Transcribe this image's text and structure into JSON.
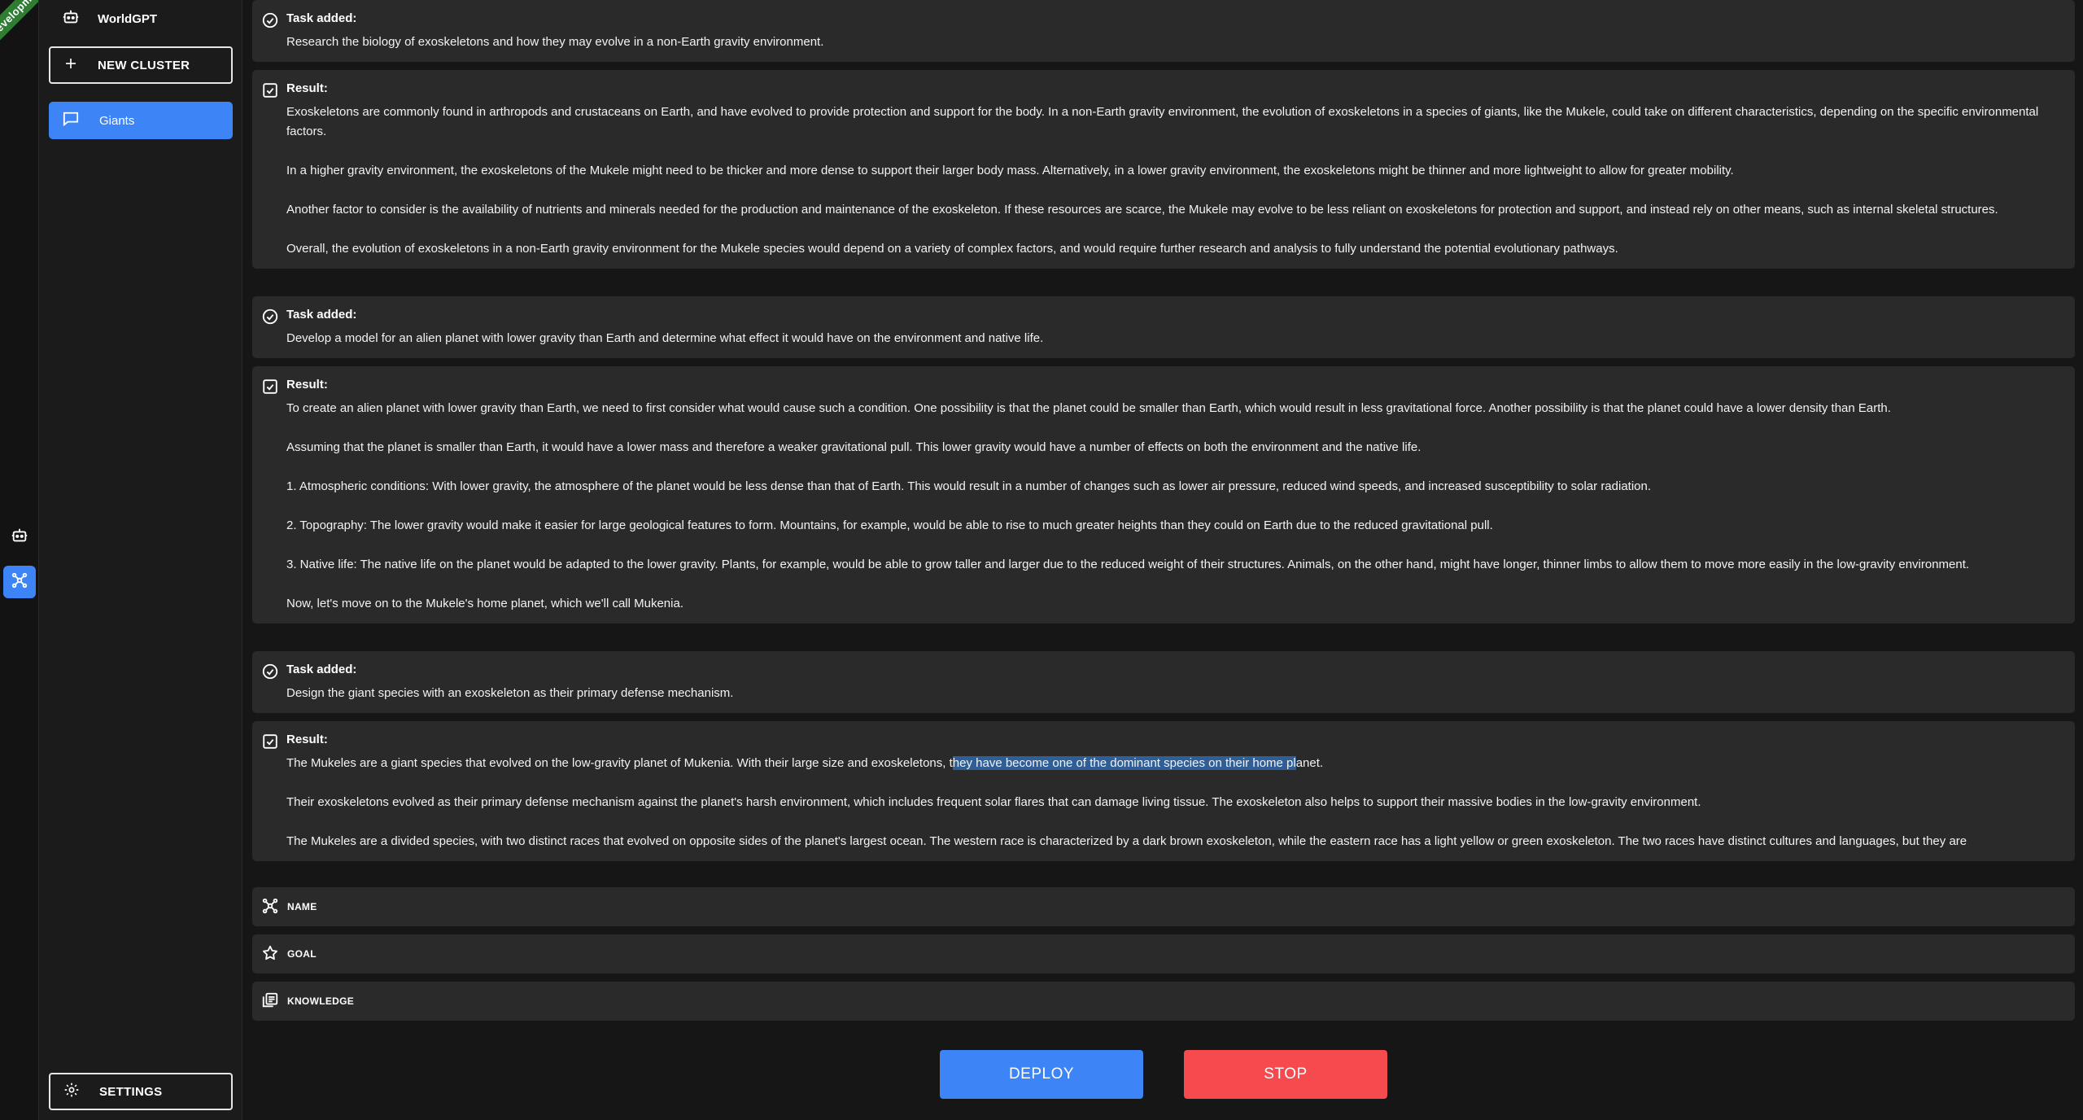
{
  "app": {
    "title": "WorldGPT",
    "ribbon_text": "Development",
    "accent_color": "#3d84f6",
    "danger_color": "#f54b4f"
  },
  "sidebar": {
    "new_cluster_label": "NEW CLUSTER",
    "clusters": [
      {
        "label": "Giants",
        "icon": "chat-bubble-icon"
      }
    ],
    "settings_label": "SETTINGS"
  },
  "feed": [
    {
      "type": "task",
      "header": "Task added:",
      "icon": "check-circle-icon",
      "paragraphs": [
        "Research the biology of exoskeletons and how they may evolve in a non-Earth gravity environment."
      ]
    },
    {
      "type": "result",
      "header": "Result:",
      "icon": "check-square-icon",
      "paragraphs": [
        "Exoskeletons are commonly found in arthropods and crustaceans on Earth, and have evolved to provide protection and support for the body. In a non-Earth gravity environment, the evolution of exoskeletons in a species of giants, like the Mukele, could take on different characteristics, depending on the specific environmental factors.",
        "In a higher gravity environment, the exoskeletons of the Mukele might need to be thicker and more dense to support their larger body mass. Alternatively, in a lower gravity environment, the exoskeletons might be thinner and more lightweight to allow for greater mobility.",
        "Another factor to consider is the availability of nutrients and minerals needed for the production and maintenance of the exoskeleton. If these resources are scarce, the Mukele may evolve to be less reliant on exoskeletons for protection and support, and instead rely on other means, such as internal skeletal structures.",
        "Overall, the evolution of exoskeletons in a non-Earth gravity environment for the Mukele species would depend on a variety of complex factors, and would require further research and analysis to fully understand the potential evolutionary pathways."
      ]
    },
    {
      "type": "task",
      "header": "Task added:",
      "icon": "check-circle-icon",
      "paragraphs": [
        "Develop a model for an alien planet with lower gravity than Earth and determine what effect it would have on the environment and native life."
      ]
    },
    {
      "type": "result",
      "header": "Result:",
      "icon": "check-square-icon",
      "paragraphs": [
        "To create an alien planet with lower gravity than Earth, we need to first consider what would cause such a condition. One possibility is that the planet could be smaller than Earth, which would result in less gravitational force. Another possibility is that the planet could have a lower density than Earth.",
        "Assuming that the planet is smaller than Earth, it would have a lower mass and therefore a weaker gravitational pull. This lower gravity would have a number of effects on both the environment and the native life.",
        "1. Atmospheric conditions: With lower gravity, the atmosphere of the planet would be less dense than that of Earth. This would result in a number of changes such as lower air pressure, reduced wind speeds, and increased susceptibility to solar radiation.",
        "2. Topography: The lower gravity would make it easier for large geological features to form. Mountains, for example, would be able to rise to much greater heights than they could on Earth due to the reduced gravitational pull.",
        "3. Native life: The native life on the planet would be adapted to the lower gravity. Plants, for example, would be able to grow taller and larger due to the reduced weight of their structures. Animals, on the other hand, might have longer, thinner limbs to allow them to move more easily in the low-gravity environment.",
        "Now, let's move on to the Mukele's home planet, which we'll call Mukenia."
      ]
    },
    {
      "type": "task",
      "header": "Task added:",
      "icon": "check-circle-icon",
      "paragraphs": [
        "Design the giant species with an exoskeleton as their primary defense mechanism."
      ]
    },
    {
      "type": "result",
      "header": "Result:",
      "icon": "check-square-icon",
      "paragraphs": [
        "Their exoskeletons evolved as their primary defense mechanism against the planet's harsh environment, which includes frequent solar flares that can damage living tissue. The exoskeleton also helps to support their massive bodies in the low-gravity environment.",
        "The Mukeles are a divided species, with two distinct races that evolved on opposite sides of the planet's largest ocean. The western race is characterized by a dark brown exoskeleton, while the eastern race has a light yellow or green exoskeleton. The two races have distinct cultures and languages, but they are"
      ],
      "first_paragraph": {
        "before": "The Mukeles are a giant species that evolved on the low-gravity planet of Mukenia. With their large size and exoskeletons, t",
        "selected": "hey have become one of the dominant species on their home pl",
        "after": "anet."
      }
    }
  ],
  "fields": {
    "name_label": "NAME",
    "goal_label": "GOAL",
    "knowledge_label": "KNOWLEDGE"
  },
  "actions": {
    "deploy_label": "DEPLOY",
    "stop_label": "STOP"
  }
}
